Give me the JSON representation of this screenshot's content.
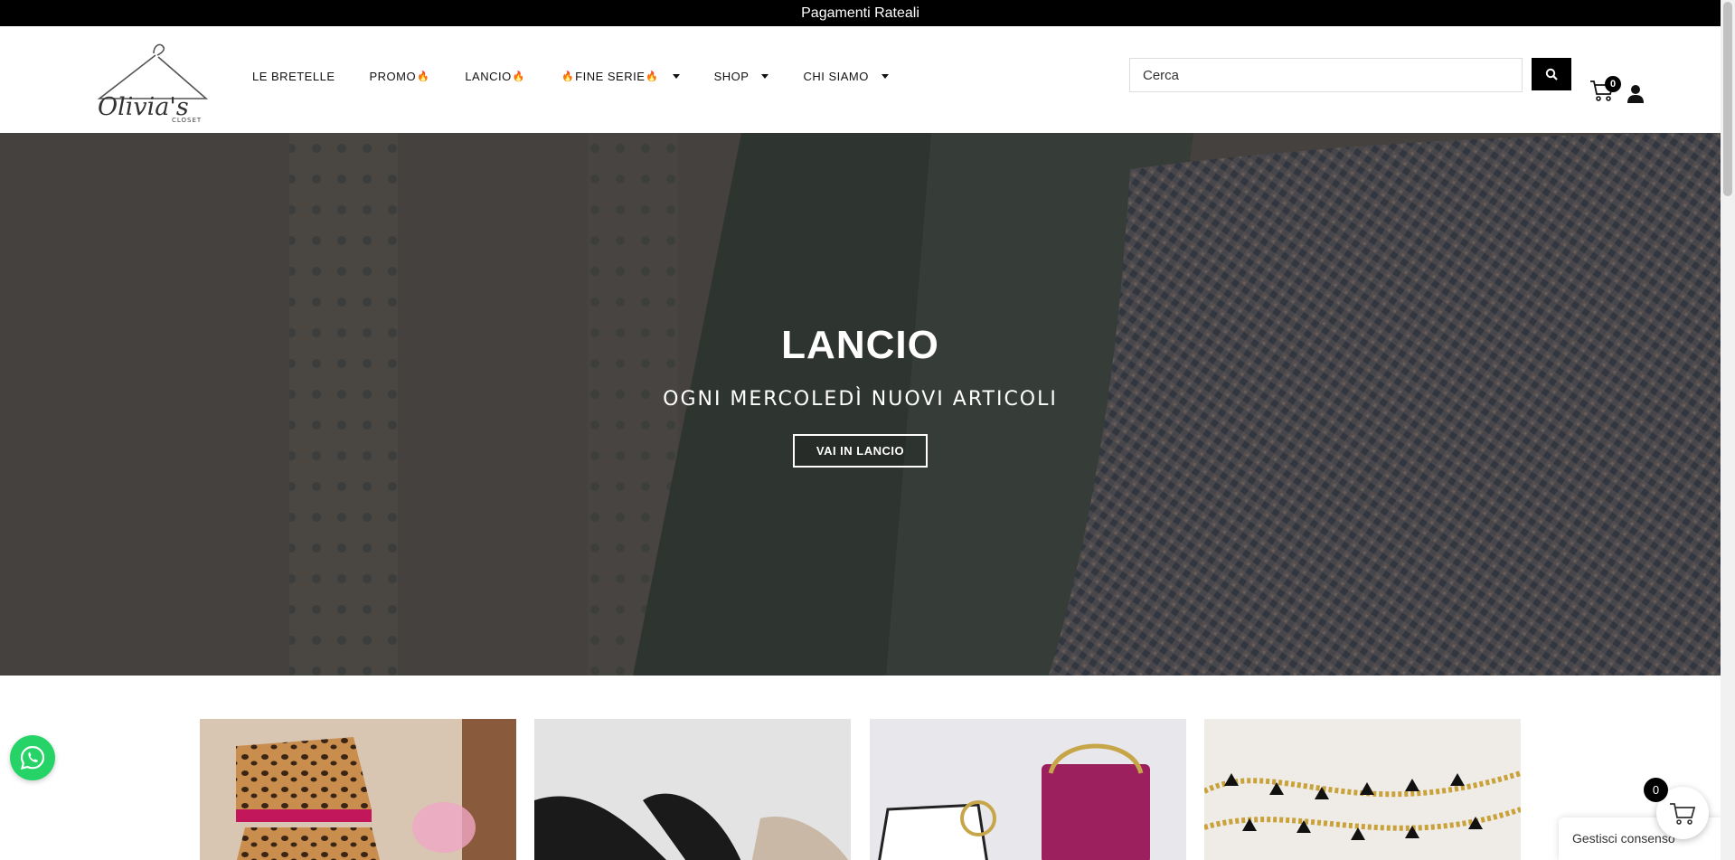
{
  "topbar": {
    "text": "Pagamenti Rateali"
  },
  "logo": {
    "text": "Olivia's",
    "subtext": "CLOSET"
  },
  "nav": {
    "items": [
      {
        "label": "LE BRETELLE",
        "fire_before": "",
        "fire_after": "",
        "dropdown": false
      },
      {
        "label": "PROMO",
        "fire_before": "",
        "fire_after": "🔥",
        "dropdown": false
      },
      {
        "label": "LANCIO",
        "fire_before": "",
        "fire_after": "🔥",
        "dropdown": false
      },
      {
        "label": "FINE SERIE",
        "fire_before": "🔥",
        "fire_after": "🔥",
        "dropdown": true
      },
      {
        "label": "SHOP",
        "fire_before": "",
        "fire_after": "",
        "dropdown": true
      },
      {
        "label": "CHI SIAMO",
        "fire_before": "",
        "fire_after": "",
        "dropdown": true
      }
    ]
  },
  "search": {
    "placeholder": "Cerca"
  },
  "cart": {
    "count": "0"
  },
  "hero": {
    "title": "LANCIO",
    "subtitle": "OGNI MERCOLEDÌ NUOVI ARTICOLI",
    "button": "VAI IN LANCIO"
  },
  "cards": [
    {
      "name": "card-leopard-outfit"
    },
    {
      "name": "card-shoes"
    },
    {
      "name": "card-bags"
    },
    {
      "name": "card-accessories"
    }
  ],
  "consent": {
    "label": "Gestisci consenso"
  },
  "float_cart": {
    "count": "0"
  },
  "colors": {
    "topbar": "#000000",
    "accent": "#000000",
    "whatsapp": "#25d366"
  }
}
